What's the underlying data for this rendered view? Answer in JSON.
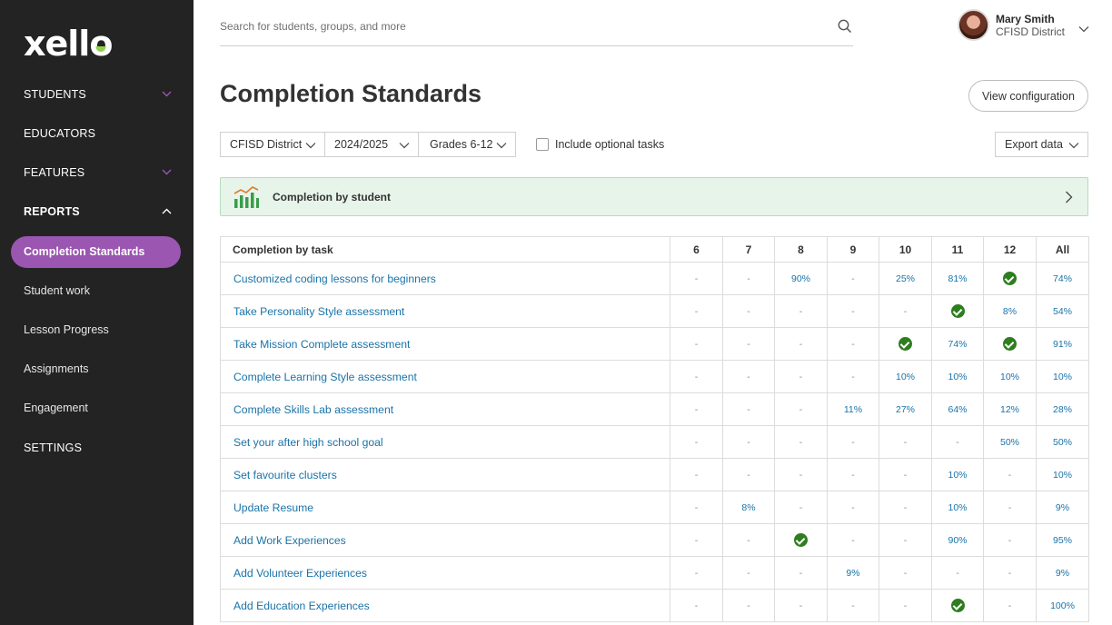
{
  "brand": {
    "logo_text_before": "xell",
    "logo_text_o": "o"
  },
  "sidebar": {
    "items": [
      {
        "label": "STUDENTS",
        "has_chevron": true,
        "expanded": false
      },
      {
        "label": "EDUCATORS",
        "has_chevron": false
      },
      {
        "label": "FEATURES",
        "has_chevron": true,
        "expanded": false
      },
      {
        "label": "REPORTS",
        "has_chevron": true,
        "expanded": true
      }
    ],
    "report_items": [
      {
        "label": "Completion Standards",
        "active": true
      },
      {
        "label": "Student work"
      },
      {
        "label": "Lesson Progress"
      },
      {
        "label": "Assignments"
      },
      {
        "label": "Engagement"
      }
    ],
    "settings_label": "SETTINGS"
  },
  "search": {
    "placeholder": "Search for students, groups, and more"
  },
  "user": {
    "name": "Mary Smith",
    "org": "CFISD District"
  },
  "page": {
    "title": "Completion Standards",
    "view_config_label": "View configuration"
  },
  "filters": {
    "district": "CFISD District",
    "year": "2024/2025",
    "grades": "Grades 6-12",
    "optional_tasks_label": "Include optional tasks",
    "optional_tasks_checked": false,
    "export_label": "Export data"
  },
  "banner": {
    "label": "Completion by student"
  },
  "table": {
    "task_header": "Completion by task",
    "columns": [
      "6",
      "7",
      "8",
      "9",
      "10",
      "11",
      "12",
      "All"
    ],
    "rows": [
      {
        "task": "Customized coding lessons for beginners",
        "values": [
          "-",
          "-",
          "90%",
          "-",
          "25%",
          "81%",
          "check",
          "74%"
        ]
      },
      {
        "task": "Take Personality Style assessment",
        "values": [
          "-",
          "-",
          "-",
          "-",
          "-",
          "check",
          "8%",
          "54%"
        ]
      },
      {
        "task": "Take Mission Complete assessment",
        "values": [
          "-",
          "-",
          "-",
          "-",
          "check",
          "74%",
          "check",
          "91%"
        ]
      },
      {
        "task": "Complete Learning Style assessment",
        "values": [
          "-",
          "-",
          "-",
          "-",
          "10%",
          "10%",
          "10%",
          "10%"
        ]
      },
      {
        "task": "Complete Skills Lab assessment",
        "values": [
          "-",
          "-",
          "-",
          "11%",
          "27%",
          "64%",
          "12%",
          "28%"
        ]
      },
      {
        "task": "Set your after high school goal",
        "values": [
          "-",
          "-",
          "-",
          "-",
          "-",
          "-",
          "50%",
          "50%"
        ]
      },
      {
        "task": "Set favourite clusters",
        "values": [
          "-",
          "-",
          "-",
          "-",
          "-",
          "10%",
          "-",
          "10%"
        ]
      },
      {
        "task": "Update Resume",
        "values": [
          "-",
          "8%",
          "-",
          "-",
          "-",
          "10%",
          "-",
          "9%"
        ]
      },
      {
        "task": "Add Work Experiences",
        "values": [
          "-",
          "-",
          "check",
          "-",
          "-",
          "90%",
          "-",
          "95%"
        ]
      },
      {
        "task": "Add Volunteer Experiences",
        "values": [
          "-",
          "-",
          "-",
          "9%",
          "-",
          "-",
          "-",
          "9%"
        ]
      },
      {
        "task": "Add Education Experiences",
        "values": [
          "-",
          "-",
          "-",
          "-",
          "-",
          "check",
          "-",
          "100%"
        ]
      }
    ]
  },
  "colors": {
    "sidebar_bg": "#232323",
    "active_pill": "#9a56b0",
    "link": "#1a73a8",
    "check": "#2e7d1f",
    "banner_bg": "#e7f4ea"
  }
}
